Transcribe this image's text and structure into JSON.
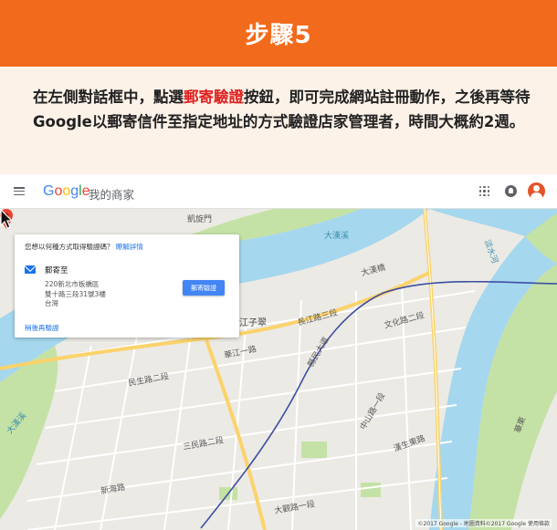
{
  "banner": {
    "title": "步驟5"
  },
  "description": {
    "part1": "在左側對話框中，點選",
    "highlight": "郵寄驗證",
    "part2": "按鈕，即可完成網站註冊動作，之後再等待Google以郵寄信件至指定地址的方式驗證店家管理者，時間大概約2週。"
  },
  "appbar": {
    "logo": {
      "letters": [
        "G",
        "o",
        "o",
        "g",
        "l",
        "e"
      ],
      "colors": [
        "#4285f4",
        "#ea4335",
        "#fbbc05",
        "#4285f4",
        "#34a853",
        "#ea4335"
      ]
    },
    "app_name": "我的商家",
    "icons": [
      "menu-icon",
      "apps-icon",
      "notifications-icon",
      "account-avatar"
    ]
  },
  "dialog": {
    "question": "您想以何種方式取得驗證碼？",
    "learn_more": "瞭解詳情",
    "method_icon": "mail-icon",
    "method": "郵寄至",
    "address_lines": [
      "220新北市板橋區",
      "雙十路三段31號3樓",
      "台灣"
    ],
    "verify_button": "郵寄驗證",
    "later_link": "稍後再驗證"
  },
  "map": {
    "labels": {
      "kailu": "凱旋門",
      "river1": "大漢溪",
      "river2": "淡水河",
      "river3": "大漢溪",
      "jiangzicui": "江子翠",
      "rd_changjiang": "長江路三段",
      "rd_wenhua": "文化路二段",
      "rd_huayang": "華江一路",
      "rd_xian": "縣民大道",
      "rd_minsheng": "民生路二段",
      "rd_zhongshan": "中山路一段",
      "rd_sanmin": "三民路二段",
      "rd_dahan": "大漢橋",
      "rd_hansheng": "漢生東路",
      "rd_xinhai": "新海路",
      "rd_beiqiao": "華東",
      "rd_daguan": "大觀路一段"
    },
    "copyright": "©2017 Google - 地圖資料©2017 Google  使用條款",
    "colors": {
      "water": "#a5d7ee",
      "park": "#c4e2a6",
      "land": "#eceae4",
      "road": "#ffffff",
      "highway": "#fbd36b",
      "metro": "#3c4fa2",
      "pin": "#ea4335"
    }
  }
}
